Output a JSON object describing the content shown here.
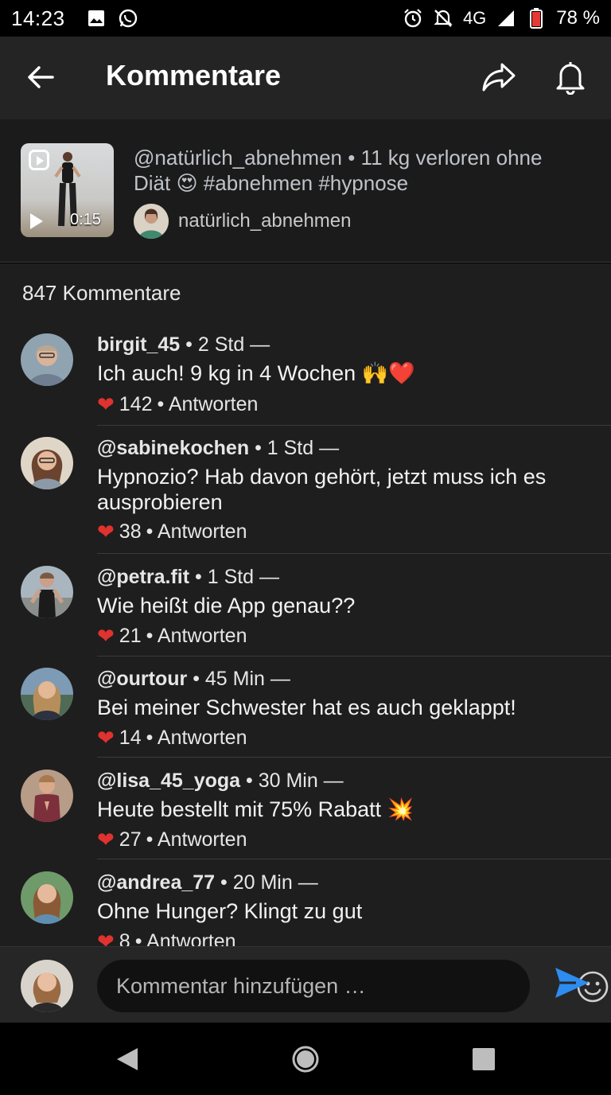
{
  "status_bar": {
    "time": "14:23",
    "network": "4G",
    "battery": "78 %",
    "icons": [
      "image-icon",
      "whatsapp-icon",
      "alarm-icon",
      "mute-icon",
      "signal-icon",
      "battery-icon"
    ]
  },
  "app_bar": {
    "title": "Kommentare",
    "back_icon": "arrow-left-icon",
    "share_icon": "share-icon",
    "bell_icon": "bell-icon"
  },
  "post": {
    "duration": "0:15",
    "caption": "@natürlich_abnehmen • 11 kg verloren ohne Diät 😍 #abnehmen #hypnose",
    "author": "natürlich_abnehmen"
  },
  "comments_count": "847 Kommentare",
  "comments": [
    {
      "user": "birgit_45",
      "time": "• 2 Std —",
      "text": "Ich auch! 9 kg in 4 Wochen 🙌❤️",
      "likes": "142",
      "reply": "• Antworten"
    },
    {
      "user": "@sabinekochen",
      "time": "• 1 Std —",
      "text": "Hypnozio? Hab davon gehört, jetzt muss ich es ausprobieren",
      "likes": "38",
      "reply": "• Antworten"
    },
    {
      "user": "@petra.fit",
      "time": "• 1 Std —",
      "text": "Wie heißt die App genau??",
      "likes": "21",
      "reply": "• Antworten"
    },
    {
      "user": "@ourtour",
      "time": "• 45 Min —",
      "text": "Bei meiner Schwester hat es auch geklappt!",
      "likes": "14",
      "reply": "• Antworten"
    },
    {
      "user": "@lisa_45_yoga",
      "time": "• 30 Min —",
      "text": "Heute bestellt mit 75% Rabatt 💥",
      "likes": "27",
      "reply": "• Antworten"
    },
    {
      "user": "@andrea_77",
      "time": "• 20 Min —",
      "text": "Ohne Hunger? Klingt zu gut",
      "likes": "8",
      "reply": "• Antworten"
    }
  ],
  "composer": {
    "placeholder": "Kommentar hinzufügen …",
    "emoji_icon": "smiley-icon",
    "send_icon": "send-icon"
  },
  "colors": {
    "accent_send": "#2d8cf0",
    "heart": "#e0322f",
    "background": "#1e1e1e"
  }
}
